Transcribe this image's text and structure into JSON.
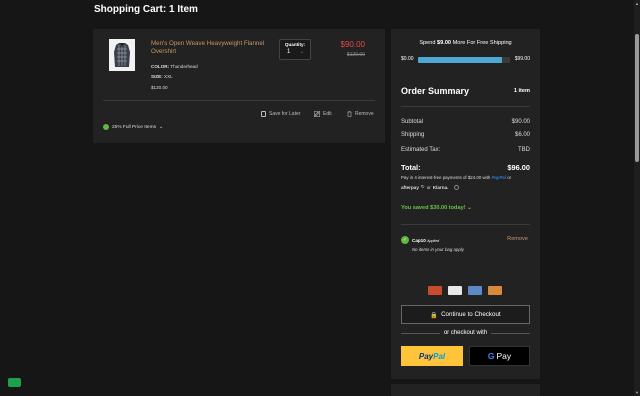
{
  "page": {
    "title": "Shopping Cart: 1 Item"
  },
  "cart_item": {
    "name": "Men's Open Weave Heavyweight Flannel Overshirt",
    "color_label": "COLOR:",
    "color_value": "Thunderhead",
    "size_label": "SIZE:",
    "size_value": "XXL",
    "unit_price": "$120.00",
    "quantity_label": "Quantity:",
    "quantity_value": "1",
    "sale_price": "$90.00",
    "original_price": "$120.00",
    "save_for_later": "Save for Later",
    "edit": "Edit",
    "remove": "Remove",
    "promo": "25% Full Price Items"
  },
  "summary": {
    "free_shipping_prefix": "Spend ",
    "free_shipping_amount": "$9.00",
    "free_shipping_suffix": " More For Free Shipping",
    "bar_min": "$0.00",
    "bar_max": "$99.00",
    "bar_progress_fraction": 0.91,
    "title": "Order Summary",
    "item_count": "1 item",
    "subtotal_label": "Subtotal",
    "subtotal_value": "$90.00",
    "shipping_label": "Shipping",
    "shipping_value": "$6.00",
    "tax_label": "Estimated Tax:",
    "tax_value": "TBD",
    "total_label": "Total:",
    "total_value": "$96.00",
    "pay_in_4": "Pay in 4 interest-free payments of $24.00 with",
    "paypal_word": "PayPal",
    "or_word": "or",
    "afterpay": "afterpay",
    "klarna": "Klarna.",
    "saved_text": "You saved $30.00 today!",
    "coupon_code": "Cap10",
    "coupon_applied": "Applied",
    "coupon_note": "No items in your bag apply",
    "coupon_remove": "Remove",
    "checkout_label": "Continue to Checkout",
    "or_checkout": "or checkout with",
    "paypal_btn_a": "Pay",
    "paypal_btn_b": "Pal",
    "gpay_g": "G",
    "gpay_label": "Pay"
  },
  "colors": {
    "accent_link": "#c8956a",
    "sale_red": "#e84848",
    "progress_blue": "#4ea8d6",
    "success_green": "#6cc24a"
  },
  "icons": [
    "bookmark-icon",
    "edit-icon",
    "trash-icon",
    "check-icon",
    "info-icon",
    "lock-icon",
    "chevron-down-icon",
    "chat-icon"
  ]
}
